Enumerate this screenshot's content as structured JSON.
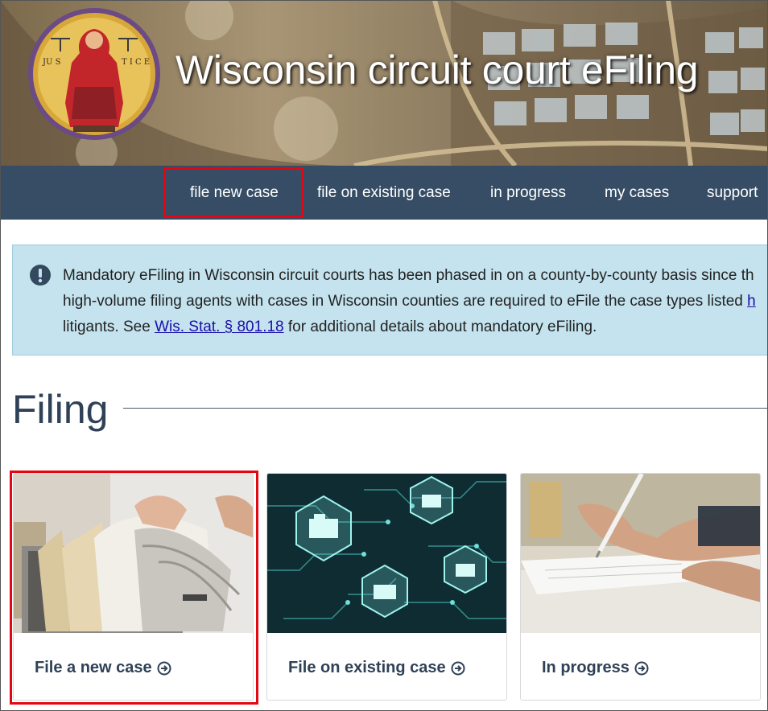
{
  "header": {
    "title": "Wisconsin circuit court eFiling",
    "seal_text_left": "JU S",
    "seal_text_right": "T I C E"
  },
  "nav": {
    "items": [
      {
        "label": "file new case",
        "selected": true
      },
      {
        "label": "file on existing case"
      },
      {
        "label": "in progress"
      },
      {
        "label": "my cases"
      },
      {
        "label": "support"
      }
    ],
    "highlight_color": "#e30613"
  },
  "alert": {
    "icon": "exclamation-circle-icon",
    "line1": "Mandatory eFiling in Wisconsin circuit courts has been phased in on a county-by-county basis since th",
    "line2_before": "high-volume filing agents with cases in Wisconsin counties are required to eFile the case types listed ",
    "line2_link": "h",
    "line3_before": "litigants. See ",
    "line3_link": "Wis. Stat. § 801.18",
    "line3_after": " for additional details about mandatory eFiling."
  },
  "section": {
    "title": "Filing"
  },
  "cards": [
    {
      "label": "File a new case",
      "icon": "arrow-right-circle-icon",
      "image": "file-drawer-photo"
    },
    {
      "label": "File on existing case",
      "icon": "arrow-right-circle-icon",
      "image": "digital-folders-circuit-photo"
    },
    {
      "label": "In progress",
      "icon": "arrow-right-circle-icon",
      "image": "hand-writing-photo"
    }
  ],
  "colors": {
    "nav_bg": "#364d65",
    "alert_bg": "#c4e3ee",
    "heading": "#2f4157",
    "highlight": "#e30613"
  }
}
